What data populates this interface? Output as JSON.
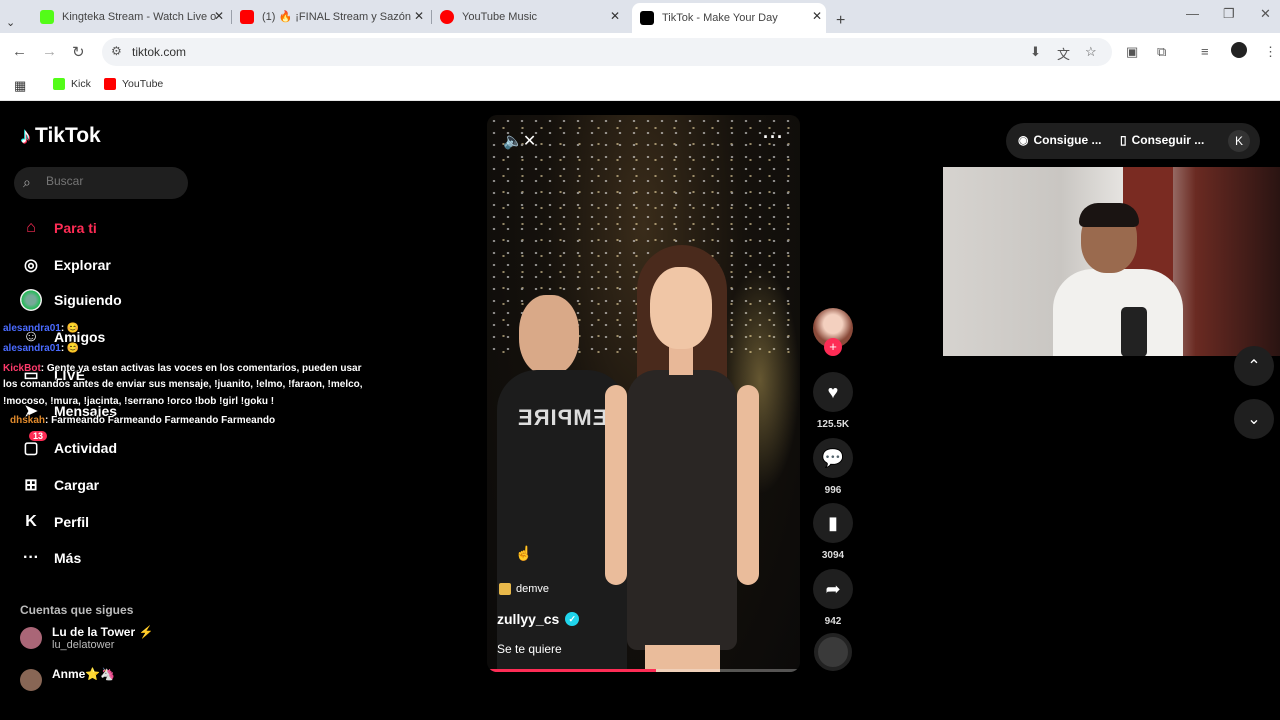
{
  "browser": {
    "tabs": [
      {
        "title": "Kingteka Stream - Watch Live o",
        "fav_color": "#53fc18"
      },
      {
        "title": "(1) 🔥 ¡FINAL Stream y Sazón! 🔥",
        "fav_color": "#ff0000"
      },
      {
        "title": "YouTube Music",
        "fav_color": "#ff0000"
      },
      {
        "title": "TikTok - Make Your Day",
        "fav_color": "#000000"
      }
    ],
    "url": "tiktok.com",
    "bookmarks": [
      {
        "label": "Kick",
        "color": "#53fc18"
      },
      {
        "label": "YouTube",
        "color": "#ff0000"
      }
    ]
  },
  "tiktok": {
    "logo": "TikTok",
    "search_placeholder": "Buscar",
    "nav": [
      {
        "label": "Para ti",
        "icon": "home-icon"
      },
      {
        "label": "Explorar",
        "icon": "compass-icon"
      },
      {
        "label": "Siguiendo",
        "icon": "following-avatar-icon"
      },
      {
        "label": "Amigos",
        "icon": "friends-icon"
      },
      {
        "label": "LIVE",
        "icon": "live-icon"
      },
      {
        "label": "Mensajes",
        "icon": "messages-icon"
      },
      {
        "label": "Actividad",
        "icon": "activity-icon",
        "badge": "13"
      },
      {
        "label": "Cargar",
        "icon": "upload-icon"
      },
      {
        "label": "Perfil",
        "icon": "profile-icon"
      },
      {
        "label": "Más",
        "icon": "more-icon"
      }
    ],
    "following_title": "Cuentas que sigues",
    "following": [
      {
        "name": "Lu de la Tower ⚡",
        "handle": "lu_delatower"
      },
      {
        "name": "Anme⭐🦄",
        "handle": ""
      }
    ],
    "video": {
      "music_tag": "demve",
      "handle": "zullyy_cs",
      "caption": "Se te quiere",
      "progress": 0.54,
      "shirt_print": "EMPIRE"
    },
    "actions": {
      "likes": "125.5K",
      "comments": "996",
      "saves": "3094",
      "shares": "942"
    },
    "top_right": {
      "btn1": "Consigue ...",
      "btn2": "Conseguir ..."
    }
  },
  "chat": [
    {
      "user": "alesandra01",
      "text": ": 😊"
    },
    {
      "user": "alesandra01",
      "text": ": 😊"
    },
    {
      "user": "KickBot",
      "text": ": Gente ya estan activas las voces en los comentarios, pueden usar"
    },
    {
      "user": "",
      "text": "los comandos antes de enviar sus mensaje, !juanito, !elmo, !faraon, !melco,"
    },
    {
      "user": "",
      "text": "!mocoso, !mura, !jacinta, !serrano !orco !bob !girl !goku !"
    },
    {
      "user": "dhskah",
      "text": ": Farmeando Farmeando Farmeando Farmeando"
    }
  ]
}
